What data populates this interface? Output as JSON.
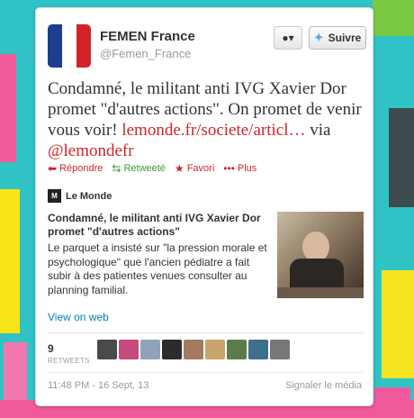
{
  "user": {
    "name": "FEMEN France",
    "handle": "@Femen_France",
    "follow_label": "Suivre",
    "user_menu_icon": "user-dropdown-icon"
  },
  "tweet": {
    "text_before_link": "Condamné, le militant anti IVG Xavier Dor promet \"d'autres actions\". On promet de venir vous voir! ",
    "link": "lemonde.fr/societe/articl…",
    "text_via": " via ",
    "mention": "@lemondefr"
  },
  "actions": {
    "reply": "Répondre",
    "retweeted": "Retweeté",
    "favorite": "Favori",
    "more": "Plus"
  },
  "card": {
    "source": "Le Monde",
    "title": "Condamné, le militant anti IVG Xavier Dor promet \"d'autres actions\"",
    "description": "Le parquet a insisté sur \"la pression morale et psychologique\" que l'ancien pédiatre a fait subir à des patientes venues consulter au planning familial.",
    "view_label": "View on web"
  },
  "stats": {
    "retweets_count": "9",
    "retweets_label": "RETWEETS"
  },
  "footer": {
    "timestamp": "11:48 PM - 16 Sept, 13",
    "report": "Signaler le média"
  },
  "colors": {
    "link": "#d2232a",
    "retweet": "#3c9a3c",
    "view_link": "#0084b4"
  }
}
